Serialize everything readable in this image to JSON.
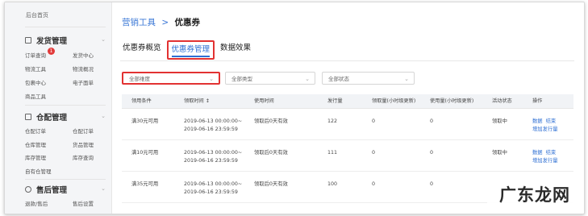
{
  "sidebar": {
    "top_item": "后台首页",
    "sections": [
      {
        "title": "发货管理",
        "icon": "document-icon",
        "items": [
          "订单查询",
          "发货中心",
          "物流工具",
          "物流概况",
          "包裹中心",
          "电子面单",
          "商品工具"
        ],
        "badge": "1"
      },
      {
        "title": "仓配管理",
        "icon": "warehouse-icon",
        "items": [
          "仓配订单",
          "仓配订单",
          "仓库管理",
          "货品管理",
          "库存管理",
          "库存查询",
          "自有仓管理"
        ]
      },
      {
        "title": "售后管理",
        "icon": "shield-icon",
        "items": [
          "退款/售后",
          "售后设置"
        ]
      }
    ]
  },
  "breadcrumb": {
    "parent": "营销工具",
    "separator": ">",
    "current": "优惠券"
  },
  "tabs": [
    {
      "label": "优惠券概览"
    },
    {
      "label": "优惠券管理"
    },
    {
      "label": "数据效果"
    }
  ],
  "filters": [
    {
      "value": "全部维度"
    },
    {
      "value": "全部类型"
    },
    {
      "value": "全部状态"
    }
  ],
  "table": {
    "headers": [
      "领用条件",
      "领取时间 ↕",
      "使用时间",
      "发行量",
      "领取量(小时级更新)",
      "使用量(小时级更新)",
      "活动状态",
      "操作"
    ],
    "rows": [
      {
        "condition": "满30元可用",
        "time_start": "2019-06-13 00:00:00~",
        "time_end": "2019-06-16 23:59:59",
        "use_time": "领取后0天有效",
        "issued": "122",
        "claimed": "0",
        "used": "0",
        "status": "领取中",
        "actions": [
          "数据",
          "结束",
          "增加发行量"
        ]
      },
      {
        "condition": "满10元可用",
        "time_start": "2019-06-13 00:00:00~",
        "time_end": "2019-06-16 23:59:59",
        "use_time": "领取后0天有效",
        "issued": "111",
        "claimed": "0",
        "used": "0",
        "status": "领取中",
        "actions": [
          "数据",
          "结束",
          "增加发行量"
        ]
      },
      {
        "condition": "满35元可用",
        "time_start": "2019-06-13 00:00:00~",
        "time_end": "2019-06-16 23:59:59",
        "use_time": "领取后0天有效",
        "issued": "100",
        "claimed": "0",
        "used": "0",
        "status": "",
        "actions": []
      }
    ]
  },
  "watermark": "广东龙网",
  "colors": {
    "accent": "#2e6fd3",
    "highlight": "#e23232",
    "badge": "#e23a3a"
  }
}
